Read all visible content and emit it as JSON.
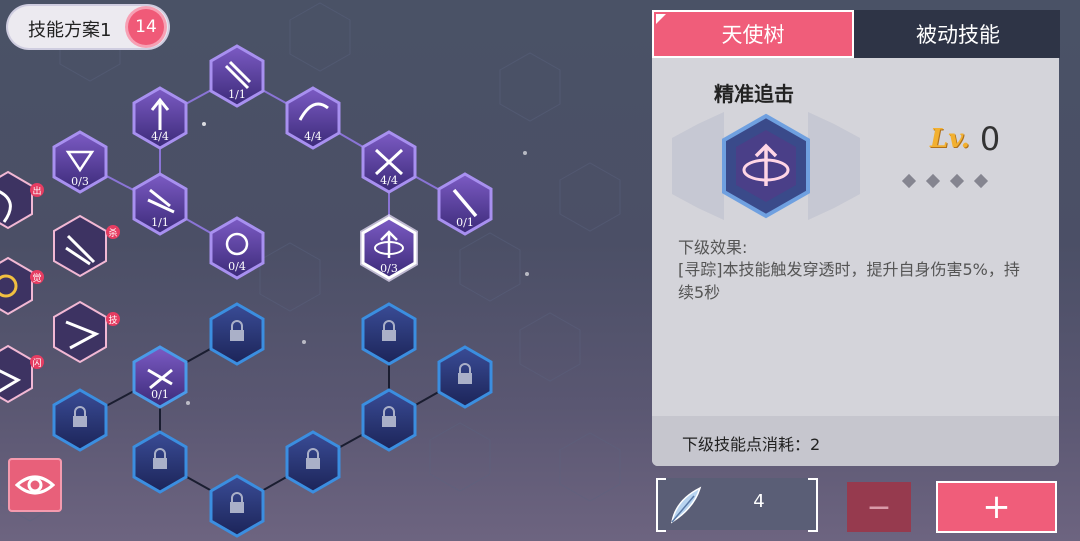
{
  "plan": {
    "label": "技能方案1",
    "points": "14"
  },
  "tabs": {
    "active": "天使树",
    "inactive": "被动技能"
  },
  "skill": {
    "name": "精准追击",
    "level_prefix": "Lv.",
    "level": "0",
    "max_level": 4,
    "effect_title": "下级效果:",
    "effect_text": "[寻踪]本技能触发穿透时，提升自身伤害5%，持续5秒",
    "cost_text": "下级技能点消耗：2"
  },
  "item": {
    "icon": "feather-icon",
    "count": "4"
  },
  "buttons": {
    "minus": "−",
    "plus": "+"
  },
  "side_tags": [
    "出",
    "杀",
    "觉",
    "技",
    "闪"
  ],
  "tree_nodes": [
    {
      "name": "node-1",
      "count": "1/1",
      "state": "unlocked"
    },
    {
      "name": "node-2",
      "count": "4/4",
      "state": "unlocked"
    },
    {
      "name": "node-3",
      "count": "4/4",
      "state": "unlocked"
    },
    {
      "name": "node-4",
      "count": "0/3",
      "state": "unlocked"
    },
    {
      "name": "node-5",
      "count": "1/1",
      "state": "unlocked"
    },
    {
      "name": "node-6",
      "count": "4/4",
      "state": "unlocked"
    },
    {
      "name": "node-7",
      "count": "0/1",
      "state": "unlocked"
    },
    {
      "name": "node-8",
      "count": "0/4",
      "state": "unlocked"
    },
    {
      "name": "node-9",
      "count": "0/3",
      "state": "selected"
    },
    {
      "name": "node-10",
      "count": "0/1",
      "state": "unlocked"
    }
  ],
  "colors": {
    "accent": "#f05d7a",
    "node_purple": "#5a3f9a",
    "node_locked": "#2a3a78",
    "panel": "#d4d4da"
  }
}
